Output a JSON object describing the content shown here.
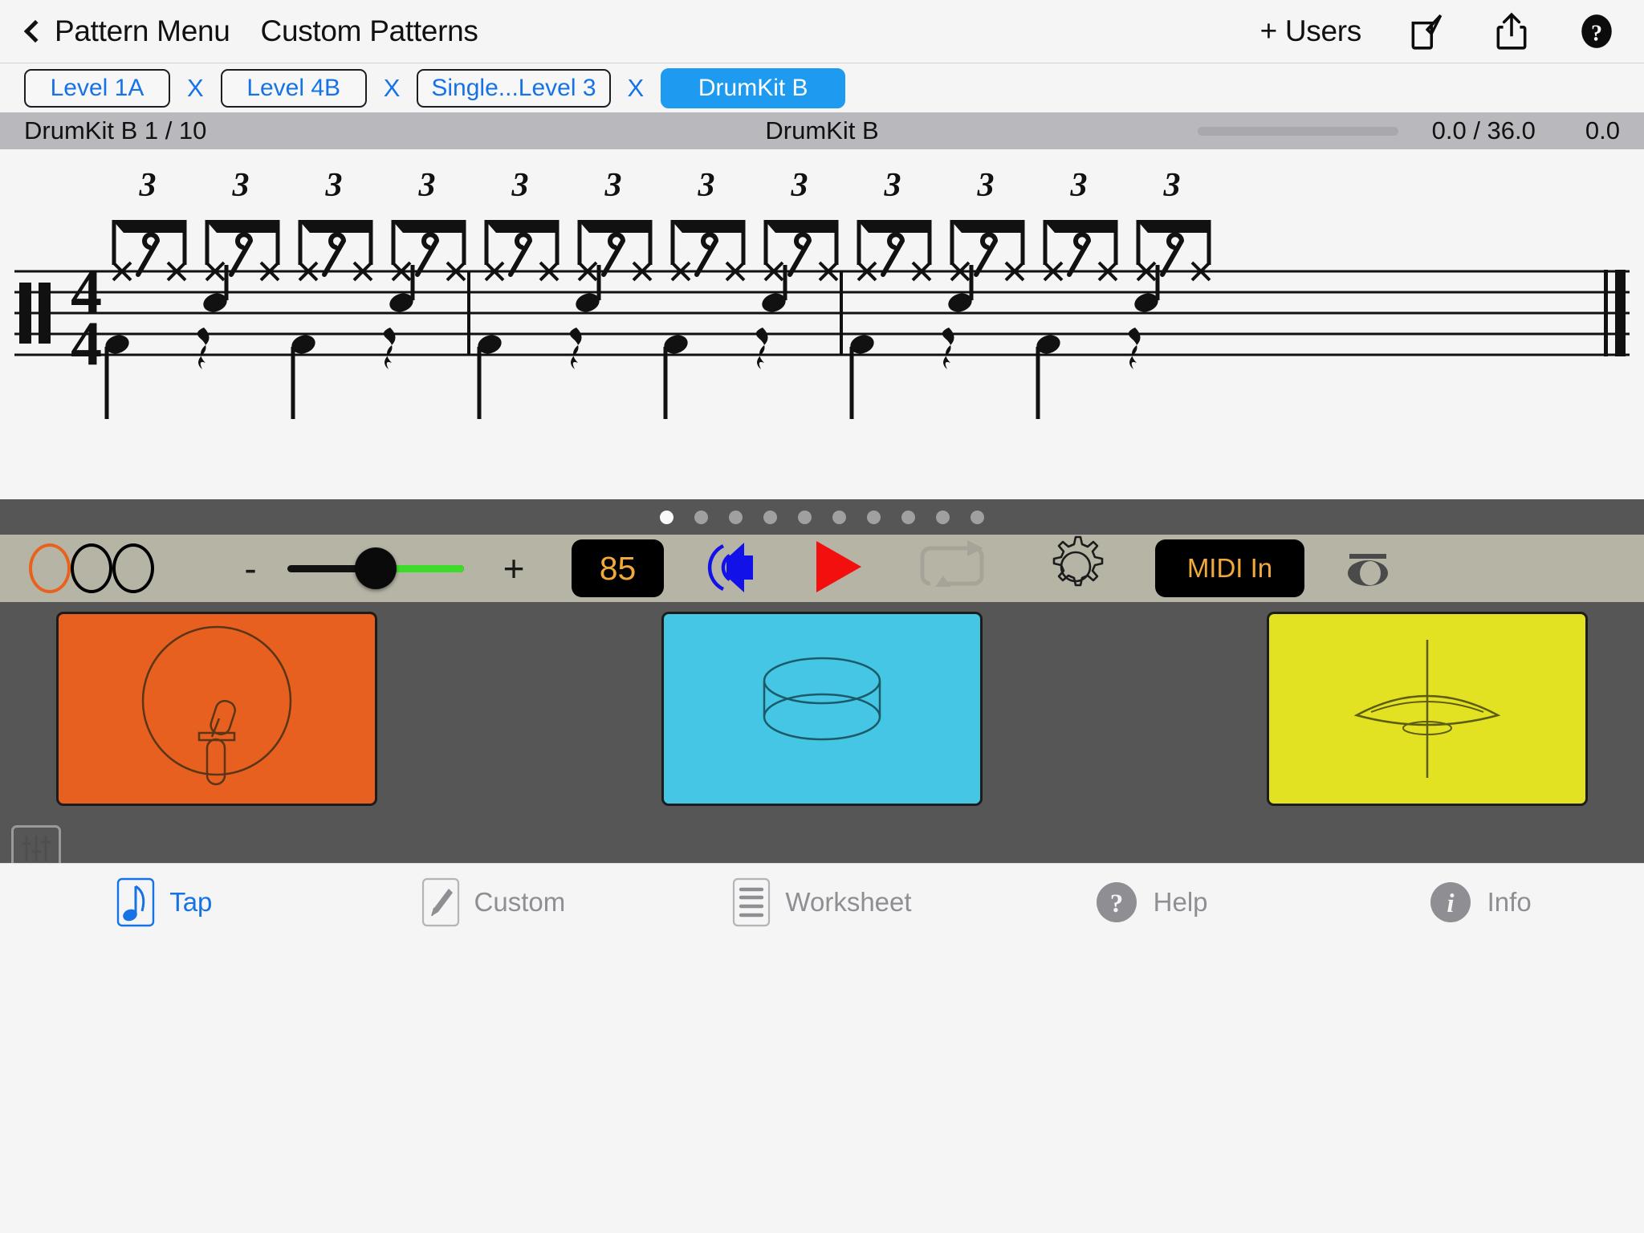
{
  "navbar": {
    "back_label": "Pattern Menu",
    "title": "Custom Patterns",
    "users_label": "+ Users",
    "icons": [
      "compose-icon",
      "share-icon",
      "help-icon"
    ]
  },
  "tabs": [
    {
      "label": "Level 1A",
      "active": false,
      "close": "X"
    },
    {
      "label": "Level 4B",
      "active": false,
      "close": "X"
    },
    {
      "label": "Single...Level 3",
      "active": false,
      "close": "X"
    },
    {
      "label": "DrumKit B",
      "active": true,
      "close": ""
    }
  ],
  "status": {
    "left": "DrumKit B 1 / 10",
    "center": "DrumKit B",
    "time": "0.0 / 36.0",
    "time2": "0.0",
    "progress_pct": 0
  },
  "notation": {
    "clef": "drum-clef",
    "time_signature_top": "4",
    "time_signature_bottom": "4",
    "tuplet_number": "3",
    "tuplet_count": 12,
    "measures": 3
  },
  "pager": {
    "count": 10,
    "active_index": 0
  },
  "transport": {
    "circles": [
      "orange",
      "black",
      "black"
    ],
    "minus_label": "-",
    "plus_label": "+",
    "volume_pct": 47,
    "tempo": "85",
    "speaker_color": "#1212e8",
    "play_color": "#f40f0f",
    "loop_enabled": false,
    "midi_label": "MIDI In",
    "accent_gold": "#f2a93b"
  },
  "pads": [
    {
      "name": "snare-pad",
      "color": "#e8601f",
      "icon": "snare-drum-icon"
    },
    {
      "name": "tom-pad",
      "color": "#44c6e4",
      "icon": "tom-drum-icon"
    },
    {
      "name": "cymbal-pad",
      "color": "#e2e222",
      "icon": "cymbal-icon"
    }
  ],
  "bottom_tabs": [
    {
      "label": "Tap",
      "icon": "eighth-note-icon",
      "active": true
    },
    {
      "label": "Custom",
      "icon": "pencil-icon",
      "active": false
    },
    {
      "label": "Worksheet",
      "icon": "lines-icon",
      "active": false
    },
    {
      "label": "Help",
      "icon": "question-circle-icon",
      "active": false
    },
    {
      "label": "Info",
      "icon": "info-circle-icon",
      "active": false
    }
  ]
}
